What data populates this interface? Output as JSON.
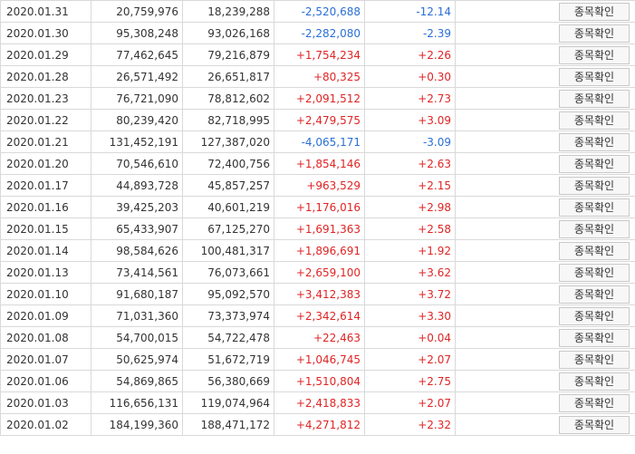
{
  "button_label": "종목확인",
  "colors": {
    "up": "#e02424",
    "down": "#2a6fd6",
    "border": "#d9d9d9"
  },
  "rows": [
    {
      "date": "2020.01.31",
      "prev": "20,759,976",
      "curr": "18,239,288",
      "change": "-2,520,688",
      "pct": "-12.14",
      "dir": "down"
    },
    {
      "date": "2020.01.30",
      "prev": "95,308,248",
      "curr": "93,026,168",
      "change": "-2,282,080",
      "pct": "-2.39",
      "dir": "down"
    },
    {
      "date": "2020.01.29",
      "prev": "77,462,645",
      "curr": "79,216,879",
      "change": "+1,754,234",
      "pct": "+2.26",
      "dir": "up"
    },
    {
      "date": "2020.01.28",
      "prev": "26,571,492",
      "curr": "26,651,817",
      "change": "+80,325",
      "pct": "+0.30",
      "dir": "up"
    },
    {
      "date": "2020.01.23",
      "prev": "76,721,090",
      "curr": "78,812,602",
      "change": "+2,091,512",
      "pct": "+2.73",
      "dir": "up"
    },
    {
      "date": "2020.01.22",
      "prev": "80,239,420",
      "curr": "82,718,995",
      "change": "+2,479,575",
      "pct": "+3.09",
      "dir": "up"
    },
    {
      "date": "2020.01.21",
      "prev": "131,452,191",
      "curr": "127,387,020",
      "change": "-4,065,171",
      "pct": "-3.09",
      "dir": "down"
    },
    {
      "date": "2020.01.20",
      "prev": "70,546,610",
      "curr": "72,400,756",
      "change": "+1,854,146",
      "pct": "+2.63",
      "dir": "up"
    },
    {
      "date": "2020.01.17",
      "prev": "44,893,728",
      "curr": "45,857,257",
      "change": "+963,529",
      "pct": "+2.15",
      "dir": "up"
    },
    {
      "date": "2020.01.16",
      "prev": "39,425,203",
      "curr": "40,601,219",
      "change": "+1,176,016",
      "pct": "+2.98",
      "dir": "up"
    },
    {
      "date": "2020.01.15",
      "prev": "65,433,907",
      "curr": "67,125,270",
      "change": "+1,691,363",
      "pct": "+2.58",
      "dir": "up"
    },
    {
      "date": "2020.01.14",
      "prev": "98,584,626",
      "curr": "100,481,317",
      "change": "+1,896,691",
      "pct": "+1.92",
      "dir": "up"
    },
    {
      "date": "2020.01.13",
      "prev": "73,414,561",
      "curr": "76,073,661",
      "change": "+2,659,100",
      "pct": "+3.62",
      "dir": "up"
    },
    {
      "date": "2020.01.10",
      "prev": "91,680,187",
      "curr": "95,092,570",
      "change": "+3,412,383",
      "pct": "+3.72",
      "dir": "up"
    },
    {
      "date": "2020.01.09",
      "prev": "71,031,360",
      "curr": "73,373,974",
      "change": "+2,342,614",
      "pct": "+3.30",
      "dir": "up"
    },
    {
      "date": "2020.01.08",
      "prev": "54,700,015",
      "curr": "54,722,478",
      "change": "+22,463",
      "pct": "+0.04",
      "dir": "up"
    },
    {
      "date": "2020.01.07",
      "prev": "50,625,974",
      "curr": "51,672,719",
      "change": "+1,046,745",
      "pct": "+2.07",
      "dir": "up"
    },
    {
      "date": "2020.01.06",
      "prev": "54,869,865",
      "curr": "56,380,669",
      "change": "+1,510,804",
      "pct": "+2.75",
      "dir": "up"
    },
    {
      "date": "2020.01.03",
      "prev": "116,656,131",
      "curr": "119,074,964",
      "change": "+2,418,833",
      "pct": "+2.07",
      "dir": "up"
    },
    {
      "date": "2020.01.02",
      "prev": "184,199,360",
      "curr": "188,471,172",
      "change": "+4,271,812",
      "pct": "+2.32",
      "dir": "up"
    }
  ]
}
